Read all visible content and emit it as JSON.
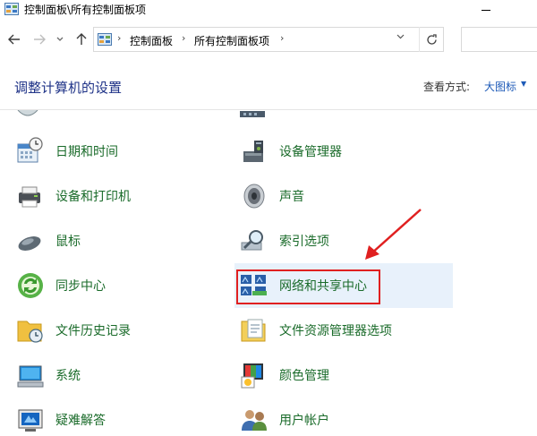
{
  "window": {
    "title": "控制面板\\所有控制面板项"
  },
  "address": {
    "crumbs": [
      "控制面板",
      "所有控制面板项"
    ]
  },
  "header": {
    "title": "调整计算机的设置",
    "view_label": "查看方式:",
    "view_value": "大图标"
  },
  "items": [
    {
      "label": "日期和时间",
      "icon": "calendar-clock-icon"
    },
    {
      "label": "设备管理器",
      "icon": "device-manager-icon"
    },
    {
      "label": "设备和打印机",
      "icon": "printer-icon"
    },
    {
      "label": "声音",
      "icon": "speaker-icon"
    },
    {
      "label": "鼠标",
      "icon": "mouse-icon"
    },
    {
      "label": "索引选项",
      "icon": "magnifier-icon"
    },
    {
      "label": "同步中心",
      "icon": "sync-icon"
    },
    {
      "label": "网络和共享中心",
      "icon": "network-icon"
    },
    {
      "label": "文件历史记录",
      "icon": "file-history-icon"
    },
    {
      "label": "文件资源管理器选项",
      "icon": "folder-options-icon"
    },
    {
      "label": "系统",
      "icon": "computer-icon"
    },
    {
      "label": "颜色管理",
      "icon": "color-management-icon"
    },
    {
      "label": "疑难解答",
      "icon": "troubleshoot-icon"
    },
    {
      "label": "用户帐户",
      "icon": "users-icon"
    }
  ],
  "colors": {
    "link_green": "#1a6b2a",
    "title_blue": "#1e3287",
    "highlight_red": "#e02020"
  }
}
